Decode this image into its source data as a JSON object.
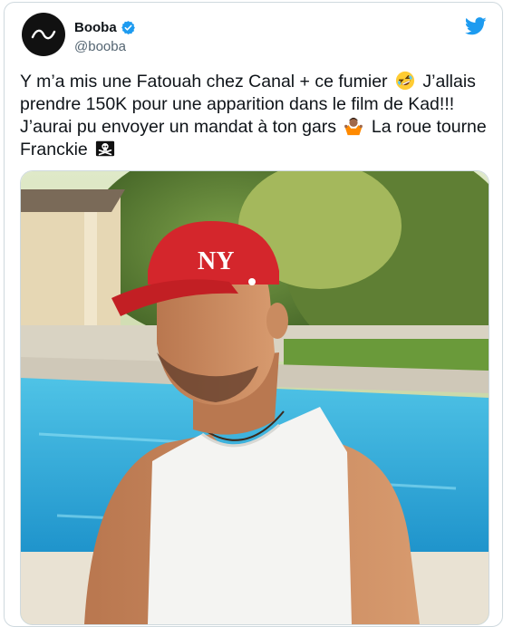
{
  "tweet": {
    "display_name": "Booba",
    "handle": "@booba",
    "lines": [
      "Y m’a mis une Fatouah chez Canal + ce fumier",
      "J’allais prendre 150K pour une apparition dans le film de Kad!!!",
      "J’aurai pu envoyer un mandat à ton gars",
      "La roue tourne Franckie"
    ],
    "verified": true
  },
  "icons": {
    "avatar": "booba-logo-avatar",
    "verified": "verified-badge-icon",
    "platform": "twitter-bird-icon",
    "emoji_1": "rolling-laughing-emoji",
    "emoji_2": "person-shrugging-emoji",
    "emoji_3": "skull-crossbones-flag-emoji"
  },
  "colors": {
    "brand_blue": "#1d9bf0",
    "text_primary": "#0f1419",
    "text_secondary": "#536471",
    "border": "#cfd9de"
  }
}
